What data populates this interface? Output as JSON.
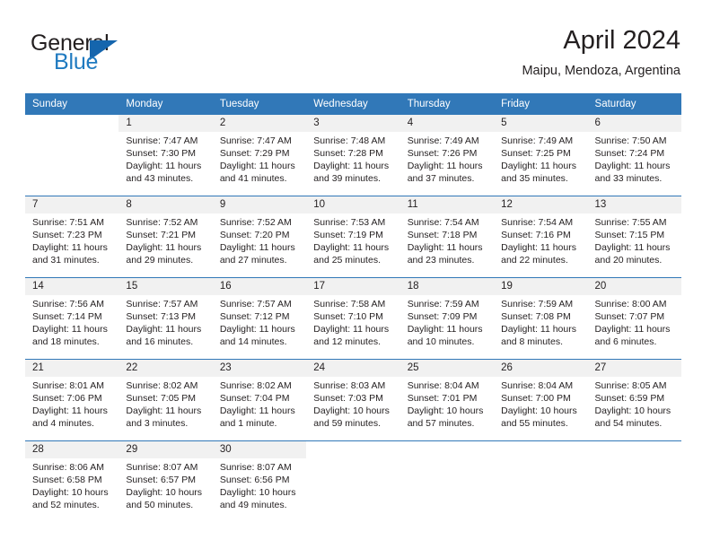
{
  "brand": {
    "name_part1": "General",
    "name_part2": "Blue",
    "triangle_color": "#1565ad",
    "blue_text_color": "#1f7ac0"
  },
  "header": {
    "title": "April 2024",
    "subtitle": "Maipu, Mendoza, Argentina"
  },
  "theme": {
    "header_blue": "#3178b8",
    "date_band": "#f1f1f1",
    "text": "#231f20"
  },
  "calendar": {
    "weekday_headers": [
      "Sunday",
      "Monday",
      "Tuesday",
      "Wednesday",
      "Thursday",
      "Friday",
      "Saturday"
    ],
    "weeks": [
      {
        "dates": [
          "",
          "1",
          "2",
          "3",
          "4",
          "5",
          "6"
        ],
        "cells": [
          {
            "empty": true
          },
          {
            "sunrise": "Sunrise: 7:47 AM",
            "sunset": "Sunset: 7:30 PM",
            "daylight1": "Daylight: 11 hours",
            "daylight2": "and 43 minutes."
          },
          {
            "sunrise": "Sunrise: 7:47 AM",
            "sunset": "Sunset: 7:29 PM",
            "daylight1": "Daylight: 11 hours",
            "daylight2": "and 41 minutes."
          },
          {
            "sunrise": "Sunrise: 7:48 AM",
            "sunset": "Sunset: 7:28 PM",
            "daylight1": "Daylight: 11 hours",
            "daylight2": "and 39 minutes."
          },
          {
            "sunrise": "Sunrise: 7:49 AM",
            "sunset": "Sunset: 7:26 PM",
            "daylight1": "Daylight: 11 hours",
            "daylight2": "and 37 minutes."
          },
          {
            "sunrise": "Sunrise: 7:49 AM",
            "sunset": "Sunset: 7:25 PM",
            "daylight1": "Daylight: 11 hours",
            "daylight2": "and 35 minutes."
          },
          {
            "sunrise": "Sunrise: 7:50 AM",
            "sunset": "Sunset: 7:24 PM",
            "daylight1": "Daylight: 11 hours",
            "daylight2": "and 33 minutes."
          }
        ]
      },
      {
        "dates": [
          "7",
          "8",
          "9",
          "10",
          "11",
          "12",
          "13"
        ],
        "cells": [
          {
            "sunrise": "Sunrise: 7:51 AM",
            "sunset": "Sunset: 7:23 PM",
            "daylight1": "Daylight: 11 hours",
            "daylight2": "and 31 minutes."
          },
          {
            "sunrise": "Sunrise: 7:52 AM",
            "sunset": "Sunset: 7:21 PM",
            "daylight1": "Daylight: 11 hours",
            "daylight2": "and 29 minutes."
          },
          {
            "sunrise": "Sunrise: 7:52 AM",
            "sunset": "Sunset: 7:20 PM",
            "daylight1": "Daylight: 11 hours",
            "daylight2": "and 27 minutes."
          },
          {
            "sunrise": "Sunrise: 7:53 AM",
            "sunset": "Sunset: 7:19 PM",
            "daylight1": "Daylight: 11 hours",
            "daylight2": "and 25 minutes."
          },
          {
            "sunrise": "Sunrise: 7:54 AM",
            "sunset": "Sunset: 7:18 PM",
            "daylight1": "Daylight: 11 hours",
            "daylight2": "and 23 minutes."
          },
          {
            "sunrise": "Sunrise: 7:54 AM",
            "sunset": "Sunset: 7:16 PM",
            "daylight1": "Daylight: 11 hours",
            "daylight2": "and 22 minutes."
          },
          {
            "sunrise": "Sunrise: 7:55 AM",
            "sunset": "Sunset: 7:15 PM",
            "daylight1": "Daylight: 11 hours",
            "daylight2": "and 20 minutes."
          }
        ]
      },
      {
        "dates": [
          "14",
          "15",
          "16",
          "17",
          "18",
          "19",
          "20"
        ],
        "cells": [
          {
            "sunrise": "Sunrise: 7:56 AM",
            "sunset": "Sunset: 7:14 PM",
            "daylight1": "Daylight: 11 hours",
            "daylight2": "and 18 minutes."
          },
          {
            "sunrise": "Sunrise: 7:57 AM",
            "sunset": "Sunset: 7:13 PM",
            "daylight1": "Daylight: 11 hours",
            "daylight2": "and 16 minutes."
          },
          {
            "sunrise": "Sunrise: 7:57 AM",
            "sunset": "Sunset: 7:12 PM",
            "daylight1": "Daylight: 11 hours",
            "daylight2": "and 14 minutes."
          },
          {
            "sunrise": "Sunrise: 7:58 AM",
            "sunset": "Sunset: 7:10 PM",
            "daylight1": "Daylight: 11 hours",
            "daylight2": "and 12 minutes."
          },
          {
            "sunrise": "Sunrise: 7:59 AM",
            "sunset": "Sunset: 7:09 PM",
            "daylight1": "Daylight: 11 hours",
            "daylight2": "and 10 minutes."
          },
          {
            "sunrise": "Sunrise: 7:59 AM",
            "sunset": "Sunset: 7:08 PM",
            "daylight1": "Daylight: 11 hours",
            "daylight2": "and 8 minutes."
          },
          {
            "sunrise": "Sunrise: 8:00 AM",
            "sunset": "Sunset: 7:07 PM",
            "daylight1": "Daylight: 11 hours",
            "daylight2": "and 6 minutes."
          }
        ]
      },
      {
        "dates": [
          "21",
          "22",
          "23",
          "24",
          "25",
          "26",
          "27"
        ],
        "cells": [
          {
            "sunrise": "Sunrise: 8:01 AM",
            "sunset": "Sunset: 7:06 PM",
            "daylight1": "Daylight: 11 hours",
            "daylight2": "and 4 minutes."
          },
          {
            "sunrise": "Sunrise: 8:02 AM",
            "sunset": "Sunset: 7:05 PM",
            "daylight1": "Daylight: 11 hours",
            "daylight2": "and 3 minutes."
          },
          {
            "sunrise": "Sunrise: 8:02 AM",
            "sunset": "Sunset: 7:04 PM",
            "daylight1": "Daylight: 11 hours",
            "daylight2": "and 1 minute."
          },
          {
            "sunrise": "Sunrise: 8:03 AM",
            "sunset": "Sunset: 7:03 PM",
            "daylight1": "Daylight: 10 hours",
            "daylight2": "and 59 minutes."
          },
          {
            "sunrise": "Sunrise: 8:04 AM",
            "sunset": "Sunset: 7:01 PM",
            "daylight1": "Daylight: 10 hours",
            "daylight2": "and 57 minutes."
          },
          {
            "sunrise": "Sunrise: 8:04 AM",
            "sunset": "Sunset: 7:00 PM",
            "daylight1": "Daylight: 10 hours",
            "daylight2": "and 55 minutes."
          },
          {
            "sunrise": "Sunrise: 8:05 AM",
            "sunset": "Sunset: 6:59 PM",
            "daylight1": "Daylight: 10 hours",
            "daylight2": "and 54 minutes."
          }
        ]
      },
      {
        "dates": [
          "28",
          "29",
          "30",
          "",
          "",
          "",
          ""
        ],
        "cells": [
          {
            "sunrise": "Sunrise: 8:06 AM",
            "sunset": "Sunset: 6:58 PM",
            "daylight1": "Daylight: 10 hours",
            "daylight2": "and 52 minutes."
          },
          {
            "sunrise": "Sunrise: 8:07 AM",
            "sunset": "Sunset: 6:57 PM",
            "daylight1": "Daylight: 10 hours",
            "daylight2": "and 50 minutes."
          },
          {
            "sunrise": "Sunrise: 8:07 AM",
            "sunset": "Sunset: 6:56 PM",
            "daylight1": "Daylight: 10 hours",
            "daylight2": "and 49 minutes."
          },
          {
            "empty": true
          },
          {
            "empty": true
          },
          {
            "empty": true
          },
          {
            "empty": true
          }
        ]
      }
    ]
  }
}
